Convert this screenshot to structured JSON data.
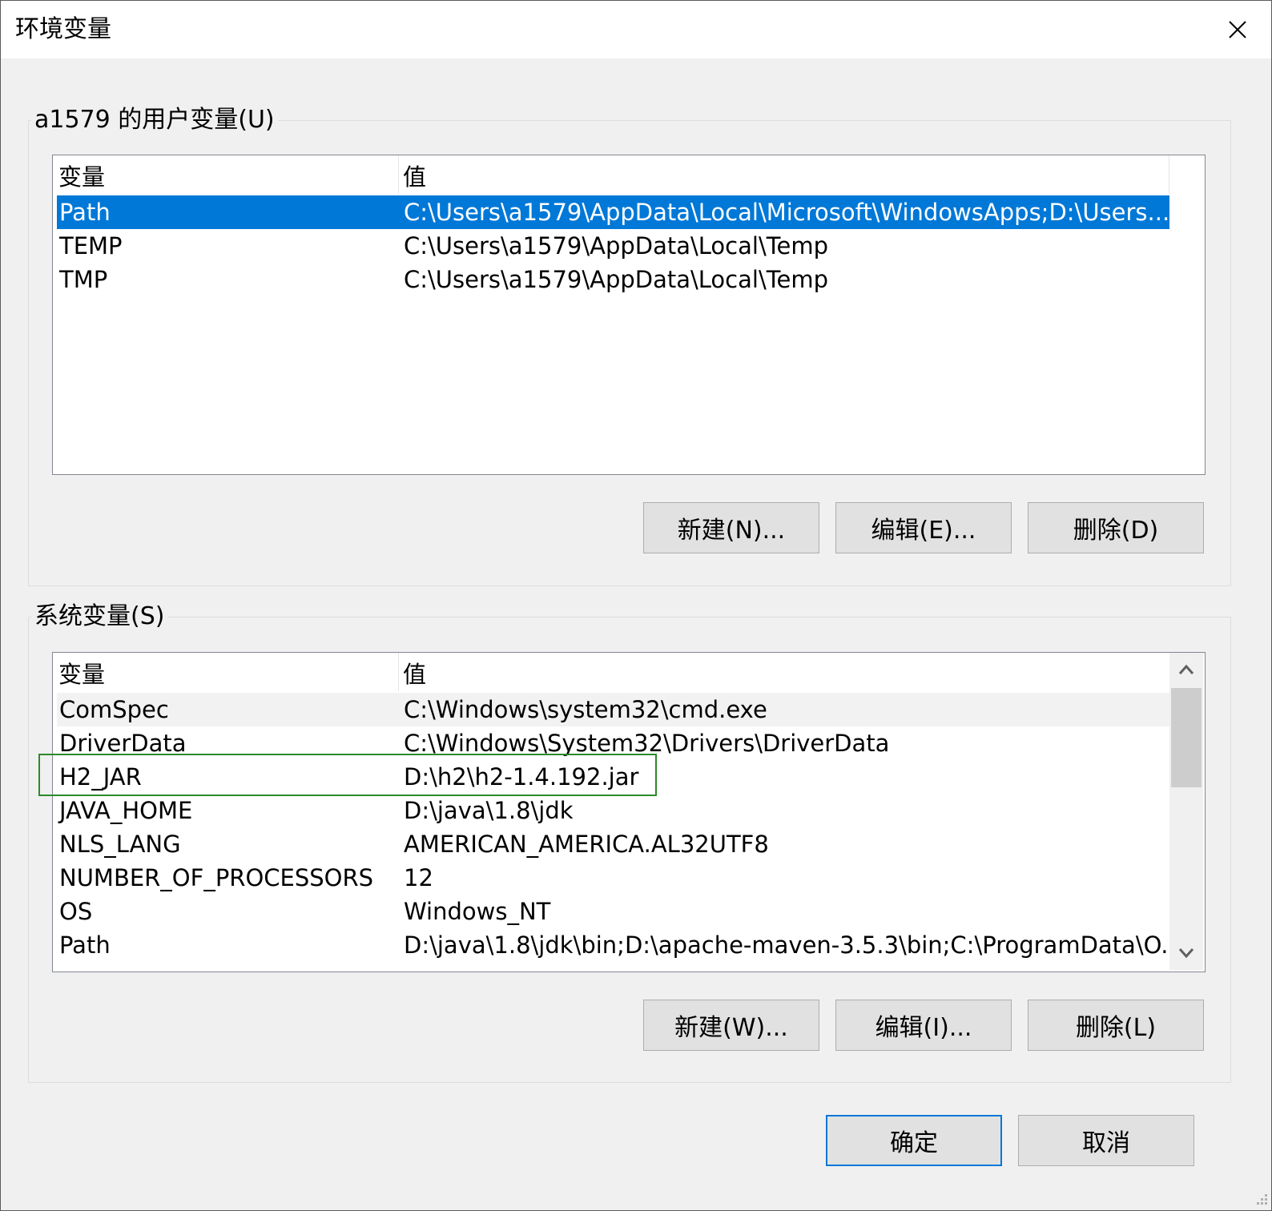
{
  "window": {
    "title": "环境变量"
  },
  "user_vars": {
    "label": "a1579 的用户变量(U)",
    "headers": {
      "name": "变量",
      "value": "值"
    },
    "rows": [
      {
        "name": "Path",
        "value": "C:\\Users\\a1579\\AppData\\Local\\Microsoft\\WindowsApps;D:\\Users..."
      },
      {
        "name": "TEMP",
        "value": "C:\\Users\\a1579\\AppData\\Local\\Temp"
      },
      {
        "name": "TMP",
        "value": "C:\\Users\\a1579\\AppData\\Local\\Temp"
      }
    ],
    "buttons": {
      "new": "新建(N)...",
      "edit": "编辑(E)...",
      "delete": "删除(D)"
    }
  },
  "system_vars": {
    "label": "系统变量(S)",
    "headers": {
      "name": "变量",
      "value": "值"
    },
    "rows": [
      {
        "name": "ComSpec",
        "value": "C:\\Windows\\system32\\cmd.exe"
      },
      {
        "name": "DriverData",
        "value": "C:\\Windows\\System32\\Drivers\\DriverData"
      },
      {
        "name": "H2_JAR",
        "value": "D:\\h2\\h2-1.4.192.jar"
      },
      {
        "name": "JAVA_HOME",
        "value": "D:\\java\\1.8\\jdk"
      },
      {
        "name": "NLS_LANG",
        "value": "AMERICAN_AMERICA.AL32UTF8"
      },
      {
        "name": "NUMBER_OF_PROCESSORS",
        "value": "12"
      },
      {
        "name": "OS",
        "value": "Windows_NT"
      },
      {
        "name": "Path",
        "value": "D:\\java\\1.8\\jdk\\bin;D:\\apache-maven-3.5.3\\bin;C:\\ProgramData\\O..."
      }
    ],
    "buttons": {
      "new": "新建(W)...",
      "edit": "编辑(I)...",
      "delete": "删除(L)"
    }
  },
  "footer": {
    "ok": "确定",
    "cancel": "取消"
  },
  "icons": {
    "close": "close-icon",
    "scroll_up": "chevron-up-icon",
    "scroll_down": "chevron-down-icon",
    "grip": "resize-grip-icon"
  },
  "colors": {
    "selection": "#0078d7",
    "highlight_box": "#2b8a2b"
  }
}
